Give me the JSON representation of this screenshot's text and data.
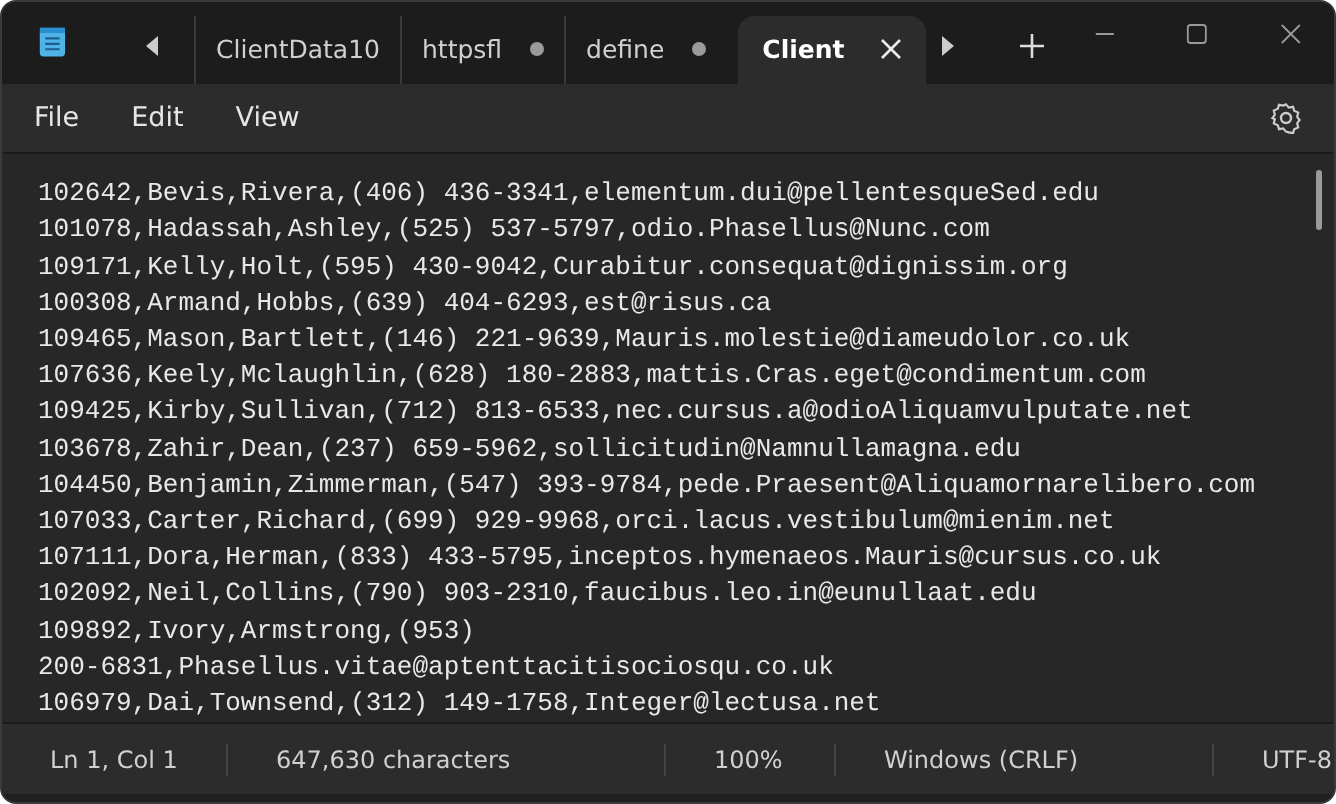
{
  "tabs": [
    {
      "label": "ClientData10",
      "selected": false,
      "modified": false,
      "closable": false
    },
    {
      "label": "httpsfl",
      "selected": false,
      "modified": true,
      "closable": false
    },
    {
      "label": "define",
      "selected": false,
      "modified": true,
      "closable": false
    },
    {
      "label": "Client",
      "selected": true,
      "modified": false,
      "closable": true
    }
  ],
  "menu": [
    "File",
    "Edit",
    "View"
  ],
  "lines": [
    "102642,Bevis,Rivera,(406) 436-3341,elementum.dui@pellentesqueSed.edu",
    "101078,Hadassah,Ashley,(525) 537-5797,odio.Phasellus@Nunc.com",
    "109171,Kelly,Holt,(595) 430-9042,Curabitur.consequat@dignissim.org",
    "100308,Armand,Hobbs,(639) 404-6293,est@risus.ca",
    "109465,Mason,Bartlett,(146) 221-9639,Mauris.molestie@diameudolor.co.uk",
    "107636,Keely,Mclaughlin,(628) 180-2883,mattis.Cras.eget@condimentum.com",
    "109425,Kirby,Sullivan,(712) 813-6533,nec.cursus.a@odioAliquamvulputate.net",
    "103678,Zahir,Dean,(237) 659-5962,sollicitudin@Namnullamagna.edu",
    "104450,Benjamin,Zimmerman,(547) 393-9784,pede.Praesent@Aliquamornarelibero.com",
    "107033,Carter,Richard,(699) 929-9968,orci.lacus.vestibulum@mienim.net",
    "107111,Dora,Herman,(833) 433-5795,inceptos.hymenaeos.Mauris@cursus.co.uk",
    "102092,Neil,Collins,(790) 903-2310,faucibus.leo.in@eunullaat.edu",
    "109892,Ivory,Armstrong,(953)",
    "200-6831,Phasellus.vitae@aptenttacitisociosqu.co.uk",
    "106979,Dai,Townsend,(312) 149-1758,Integer@lectusa.net"
  ],
  "status_bar": [
    "Ln 1, Col 1",
    "647,630 characters",
    "100%",
    "Windows (CRLF)",
    "UTF-8"
  ]
}
